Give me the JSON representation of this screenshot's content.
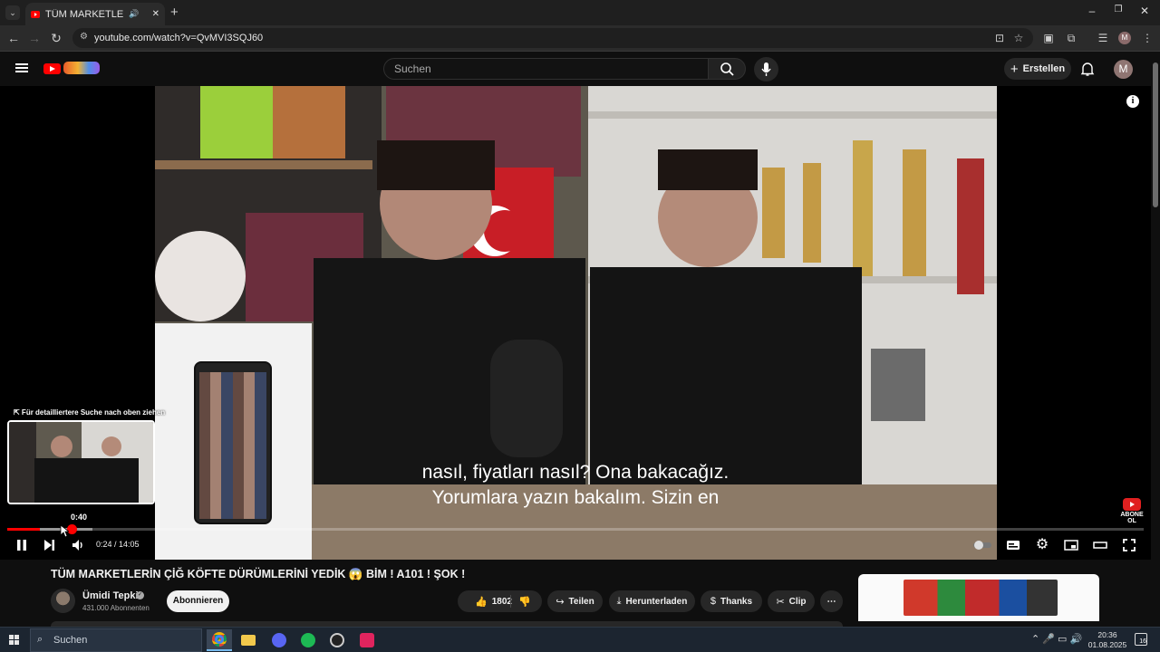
{
  "browser": {
    "tab_title": "TÜM MARKETLERİN ÇİĞ KÖ",
    "new_tab": "+",
    "url": "youtube.com/watch?v=QvMVI3SQJ60",
    "profile_initial": "M",
    "window_controls": [
      "–",
      "❐",
      "✕"
    ]
  },
  "youtube": {
    "search_placeholder": "Suchen",
    "create_label": "Erstellen",
    "avatar_initial": "M"
  },
  "player": {
    "subtitle_line1": "nasıl, fiyatları nasıl? Ona bakacağız.",
    "subtitle_line2": "Yorumlara yazın bakalım. Sizin en",
    "hint_text": "⇱ Für detailliertere Suche nach oben ziehen",
    "preview_time": "0:40",
    "time_display": "0:24 / 14:05",
    "progress": {
      "played_fraction": 0.029,
      "buffered_fraction": 0.075,
      "hover_fraction": 0.047
    },
    "abone_text": "ABONE OL",
    "info_glyph": "i"
  },
  "video": {
    "title": "TÜM MARKETLERİN ÇİĞ KÖFTE DÜRÜMLERİNİ YEDİK 😱 BİM ! A101 ! ŞOK !",
    "channel_name": "Ümidi Tepki",
    "subscriber_count": "431.000 Abonnenten",
    "subscribe_label": "Abonnieren",
    "like_count": "1802",
    "share_label": "Teilen",
    "download_label": "Herunterladen",
    "thanks_label": "Thanks",
    "clip_label": "Clip",
    "more_label": "⋯"
  },
  "taskbar": {
    "search_placeholder": "Suchen",
    "clock_time": "20:36",
    "clock_date": "01.08.2025",
    "notification_count": "16"
  },
  "colors": {
    "accent_red": "#ff0000",
    "background": "#0f0f0f",
    "pill": "#272727"
  }
}
